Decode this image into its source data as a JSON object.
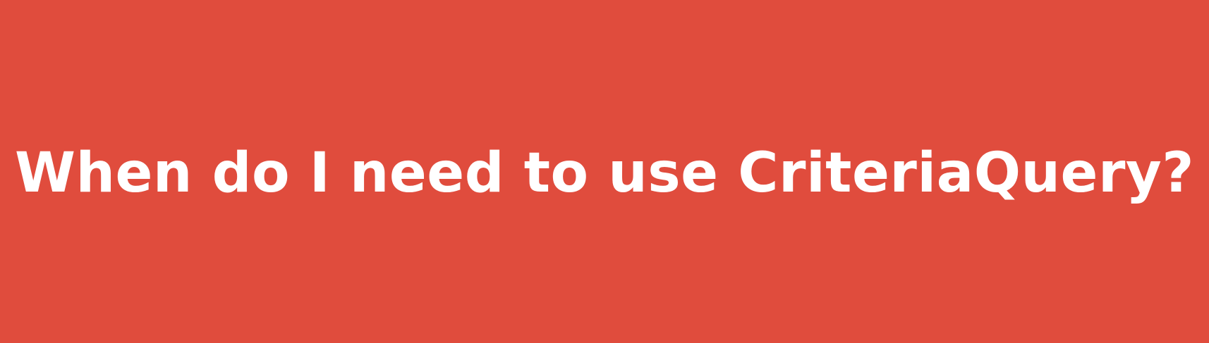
{
  "banner": {
    "title": "When do I need to use CriteriaQuery?",
    "background_color": "#E04C3D",
    "text_color": "#FFFFFF"
  }
}
